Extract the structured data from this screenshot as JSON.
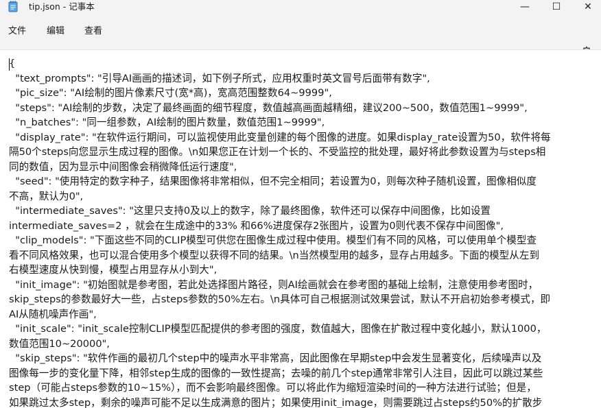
{
  "window": {
    "title": "tip.json - 记事本",
    "minimize_glyph": "—",
    "maximize_glyph": "☐",
    "close_glyph": "✕",
    "icon": "notepad-icon"
  },
  "menu": {
    "file": "文件",
    "edit": "编辑",
    "view": "查看",
    "settings_icon": "gear-icon"
  },
  "editor": {
    "lines": [
      "{",
      "  \"text_prompts\": \"引导AI画画的描述词，如下例子所式，应用权重时英文冒号后面带有数字\",",
      "  \"pic_size\": \"AI绘制的图片像素尺寸(宽*高)，宽高范围整数64~9999\",",
      "  \"steps\": \"AI绘制的步数，决定了最终画面的细节程度，数值越高画面越精细，建议200~500，数值范围1~9999\",",
      "  \"n_batches\": \"同一组参数，AI绘制的图片数量，数值范围1~9999\",",
      "  \"display_rate\": \"在软件运行期间，可以监视使用此变量创建的每个图像的进度。如果display_rate设置为50，软件将每",
      "隔50个steps向您显示生成过程的图像。\\n如果您正在计划一个长的、不受监控的批处理，最好将此参数设置为与steps相",
      "同的数值，因为显示中间图像会稍微降低运行速度\",",
      "  \"seed\": \"使用特定的数字种子，结果图像将非常相似，但不完全相同；若设置为0，则每次种子随机设置，图像相似度",
      "不高，默认为0\",",
      "  \"intermediate_saves\": \"这里只支持0及以上的数字，除了最终图像，软件还可以保存中间图像，比如设置",
      "intermediate_saves=2 ，就会在生成途中的33% 和66%进度保存2张图片，设置为0则代表不保存中间图像\",",
      "  \"clip_models\": \"下面这些不同的CLIP模型可供您在图像生成过程中使用。模型们有不同的风格，可以使用单个模型查",
      "看不同风格效果，也可以混合使用多个模型以获得不同的结果。\\n当然模型用的越多，显存占用越多。下面的模型从左到",
      "右模型速度从快到慢，模型占用显存从小到大\",",
      "  \"init_image\": \"初始图就是参考图，若此处选择图片路径，则AI绘画就会在参考图的基础上绘制，注意使用参考图时，",
      "skip_steps的参数最好大一些，占steps参数的50%左右。\\n具体可自己根据测试效果尝试，默认不开启初始参考模式，即",
      "AI从随机噪声作画\",",
      "  \"init_scale\": \"init_scale控制CLIP模型匹配提供的参考图的强度，数值越大，图像在扩散过程中变化越小，默认1000，",
      "数值范围10~20000\",",
      "  \"skip_steps\": \"软件作画的最初几个step中的噪声水平非常高，因此图像在早期step中会发生显著变化，后续噪声以及",
      "图像每一步的变化量下降，相邻step生成的图像的一致性提高；去噪的前几个step通常非常引人注目，因此可以跳过某些",
      "step（可能占steps参数的10~15%），而不会影响最终图像。可以将此作为缩短渲染时间的一种方法进行试验；但是，",
      "如果跳过太多step，剩余的噪声可能不足以生成满意的图片；如果使用init_image，则需要跳过占steps约50%的扩散步"
    ]
  }
}
